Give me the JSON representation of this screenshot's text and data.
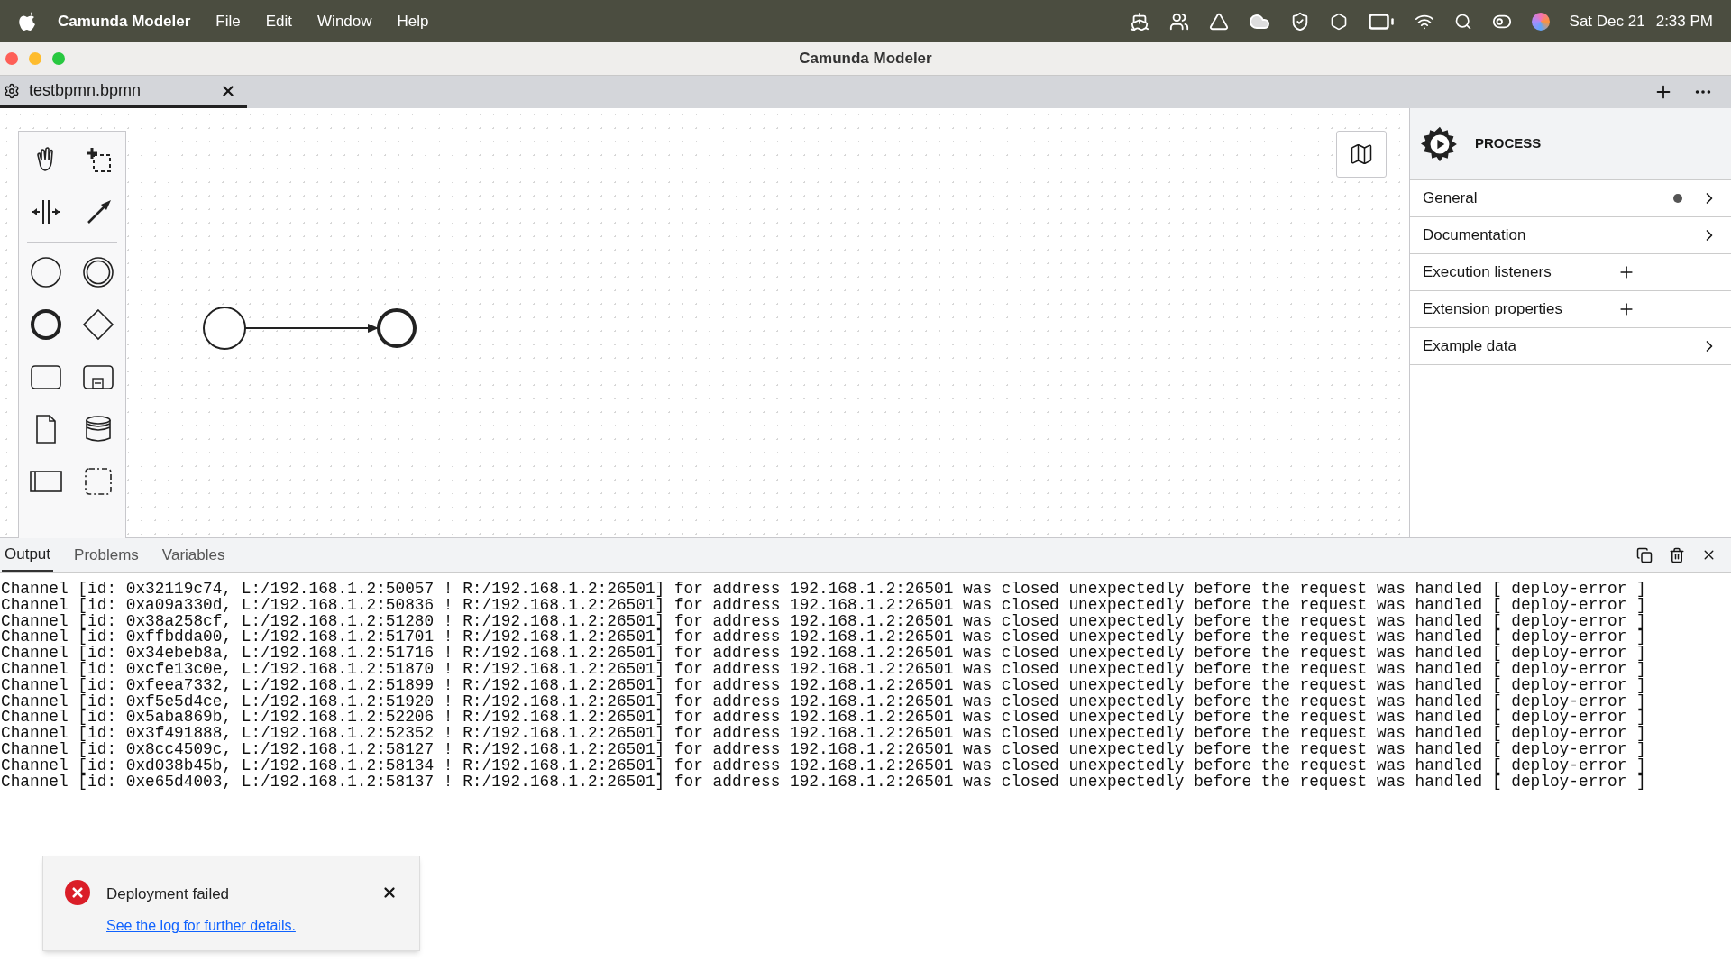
{
  "menu_bar": {
    "app_name": "Camunda Modeler",
    "menus": [
      "File",
      "Edit",
      "Window",
      "Help"
    ],
    "date": "Sat Dec 21",
    "time": "2:33 PM"
  },
  "window": {
    "title": "Camunda Modeler"
  },
  "file_tabs": [
    {
      "label": "testbpmn.bpmn",
      "selected": true
    }
  ],
  "properties_panel": {
    "title": "PROCESS",
    "groups": [
      {
        "label": "General",
        "kind": "expand",
        "has_data": true
      },
      {
        "label": "Documentation",
        "kind": "expand",
        "has_data": false
      },
      {
        "label": "Execution listeners",
        "kind": "add",
        "has_data": false
      },
      {
        "label": "Extension properties",
        "kind": "add",
        "has_data": false
      },
      {
        "label": "Example data",
        "kind": "expand",
        "has_data": false
      }
    ]
  },
  "bottom_panel": {
    "tabs": [
      {
        "label": "Output",
        "selected": true
      },
      {
        "label": "Problems",
        "selected": false
      },
      {
        "label": "Variables",
        "selected": false
      }
    ],
    "log": [
      "Channel [id: 0x32119c74, L:/192.168.1.2:50057 ! R:/192.168.1.2:26501] for address 192.168.1.2:26501 was closed unexpectedly before the request was handled [ deploy-error ]",
      "Channel [id: 0xa09a330d, L:/192.168.1.2:50836 ! R:/192.168.1.2:26501] for address 192.168.1.2:26501 was closed unexpectedly before the request was handled [ deploy-error ]",
      "Channel [id: 0x38a258cf, L:/192.168.1.2:51280 ! R:/192.168.1.2:26501] for address 192.168.1.2:26501 was closed unexpectedly before the request was handled [ deploy-error ]",
      "Channel [id: 0xffbdda00, L:/192.168.1.2:51701 ! R:/192.168.1.2:26501] for address 192.168.1.2:26501 was closed unexpectedly before the request was handled [ deploy-error ]",
      "Channel [id: 0x34ebeb8a, L:/192.168.1.2:51716 ! R:/192.168.1.2:26501] for address 192.168.1.2:26501 was closed unexpectedly before the request was handled [ deploy-error ]",
      "Channel [id: 0xcfe13c0e, L:/192.168.1.2:51870 ! R:/192.168.1.2:26501] for address 192.168.1.2:26501 was closed unexpectedly before the request was handled [ deploy-error ]",
      "Channel [id: 0xfeea7332, L:/192.168.1.2:51899 ! R:/192.168.1.2:26501] for address 192.168.1.2:26501 was closed unexpectedly before the request was handled [ deploy-error ]",
      "Channel [id: 0xf5e5d4ce, L:/192.168.1.2:51920 ! R:/192.168.1.2:26501] for address 192.168.1.2:26501 was closed unexpectedly before the request was handled [ deploy-error ]",
      "Channel [id: 0x5aba869b, L:/192.168.1.2:52206 ! R:/192.168.1.2:26501] for address 192.168.1.2:26501 was closed unexpectedly before the request was handled [ deploy-error ]",
      "Channel [id: 0x3f491888, L:/192.168.1.2:52352 ! R:/192.168.1.2:26501] for address 192.168.1.2:26501 was closed unexpectedly before the request was handled [ deploy-error ]",
      "Channel [id: 0x8cc4509c, L:/192.168.1.2:58127 ! R:/192.168.1.2:26501] for address 192.168.1.2:26501 was closed unexpectedly before the request was handled [ deploy-error ]",
      "Channel [id: 0xd038b45b, L:/192.168.1.2:58134 ! R:/192.168.1.2:26501] for address 192.168.1.2:26501 was closed unexpectedly before the request was handled [ deploy-error ]",
      "Channel [id: 0xe65d4003, L:/192.168.1.2:58137 ! R:/192.168.1.2:26501] for address 192.168.1.2:26501 was closed unexpectedly before the request was handled [ deploy-error ]"
    ]
  },
  "notification": {
    "title": "Deployment failed",
    "link": "See the log for further details."
  }
}
